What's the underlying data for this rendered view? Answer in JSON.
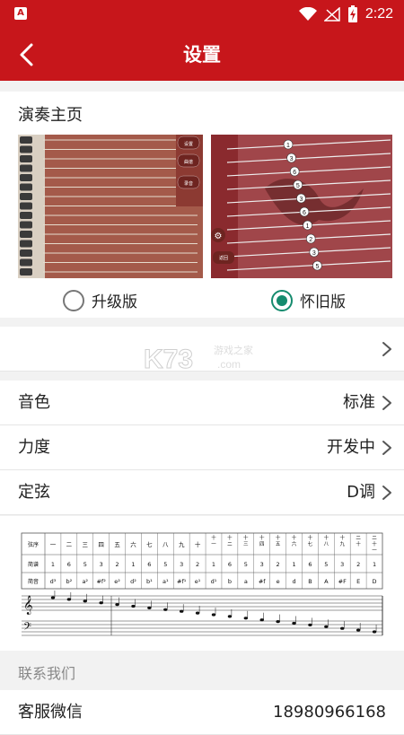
{
  "status_bar": {
    "time": "2:22"
  },
  "header": {
    "title": "设置"
  },
  "play_home": {
    "title": "演奏主页",
    "options": [
      {
        "label": "升级版",
        "selected": false
      },
      {
        "label": "怀旧版",
        "selected": true
      }
    ],
    "preview_right_numbers": [
      "1",
      "3",
      "6",
      "5",
      "3",
      "6",
      "1",
      "2",
      "3",
      "5"
    ],
    "preview_left_buttons": [
      "设置",
      "曲谱",
      "录音"
    ],
    "preview_right_button": "返回"
  },
  "watermark": {
    "brand": "K73",
    "site": "游戏之家",
    "domain": ".com"
  },
  "settings": {
    "timbre": {
      "label": "音色",
      "value": "标准"
    },
    "strength": {
      "label": "力度",
      "value": "开发中"
    },
    "tuning": {
      "label": "定弦",
      "value": "D调"
    }
  },
  "tuning_table": {
    "row_labels": [
      "弦序",
      "简谱",
      "简音"
    ],
    "string_order": [
      "一",
      "二",
      "三",
      "四",
      "五",
      "六",
      "七",
      "八",
      "九",
      "十",
      "十一",
      "十二",
      "十三",
      "十四",
      "十五",
      "十六",
      "十七",
      "十八",
      "十九",
      "二十",
      "二十一"
    ],
    "jianpu": [
      "1",
      "6",
      "5",
      "3",
      "2",
      "1",
      "6",
      "5",
      "3",
      "2",
      "1",
      "6",
      "5",
      "3",
      "2",
      "1",
      "6",
      "5",
      "3",
      "2",
      "1"
    ],
    "notes": [
      "d³",
      "b²",
      "a²",
      "#f²",
      "e²",
      "d²",
      "b¹",
      "a¹",
      "#f¹",
      "e¹",
      "d¹",
      "b",
      "a",
      "#f",
      "e",
      "d",
      "B",
      "A",
      "#F",
      "E",
      "D"
    ]
  },
  "contact": {
    "section_title": "联系我们",
    "wechat_label": "客服微信",
    "wechat_value": "18980966168"
  }
}
